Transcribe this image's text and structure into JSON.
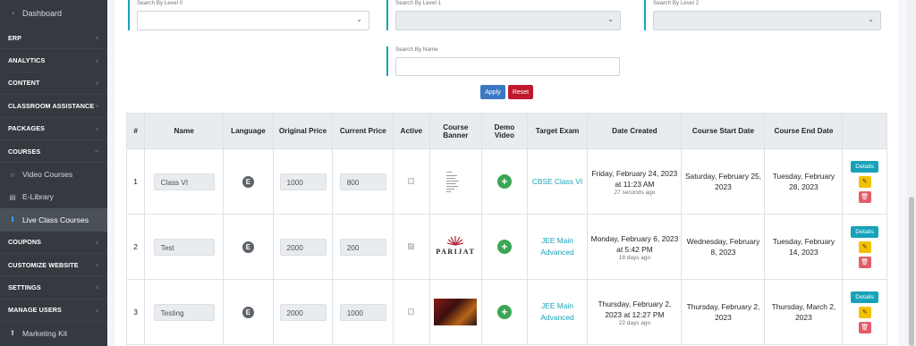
{
  "sidebar": {
    "dashboard": "Dashboard",
    "items": {
      "erp": "ERP",
      "analytics": "ANALYTICS",
      "content": "CONTENT",
      "classroom": "CLASSROOM ASSISTANCE",
      "packages": "PACKAGES",
      "courses": "COURSES",
      "coupons": "COUPONS",
      "customize": "CUSTOMIZE WEBSITE",
      "settings": "SETTINGS",
      "manage_users": "MANAGE USERS"
    },
    "sub": {
      "video": "Video Courses",
      "elibrary": "E-Library",
      "live": "Live Class Courses"
    },
    "marketing": "Marketing Kit",
    "chev": "‹",
    "icons": [
      "dashboard-icon",
      "video-icon",
      "library-icon",
      "live-class-icon",
      "marketing-icon"
    ]
  },
  "filters": {
    "level0": "Search By Level 0",
    "level1": "Search By Level 1",
    "level2": "Search By Level 2",
    "name": "Search By Name",
    "caret": "⌄"
  },
  "buttons": {
    "apply": "Apply",
    "reset": "Reset"
  },
  "table": {
    "headers": {
      "num": "#",
      "name": "Name",
      "language": "Language",
      "original_price": "Original Price",
      "current_price": "Current Price",
      "active": "Active",
      "banner": "Course Banner",
      "demo": "Demo Video",
      "target": "Target Exam",
      "created": "Date Created",
      "start": "Course Start Date",
      "end": "Course End Date"
    },
    "rows": [
      {
        "num": "1",
        "name": "Class VI",
        "lang": "E",
        "original": "1000",
        "current": "800",
        "active": false,
        "banner": "document",
        "target": "CBSE Class VI",
        "created": "Friday, February 24, 2023 at 11:23 AM",
        "created_ago": "27 seconds ago",
        "start": "Saturday, February 25, 2023",
        "end": "Tuesday, February 28, 2023"
      },
      {
        "num": "2",
        "name": "Test",
        "lang": "E",
        "original": "2000",
        "current": "200",
        "active": true,
        "banner": "parijat",
        "target": "JEE Main Advanced",
        "created": "Monday, February 6, 2023 at 5:42 PM",
        "created_ago": "18 days ago",
        "start": "Wednesday, February 8, 2023",
        "end": "Tuesday, February 14, 2023"
      },
      {
        "num": "3",
        "name": "Testing",
        "lang": "E",
        "original": "2000",
        "current": "1000",
        "active": false,
        "banner": "photo",
        "target": "JEE Main Advanced",
        "created": "Thursday, February 2, 2023 at 12:27 PM",
        "created_ago": "22 days ago",
        "start": "Thursday, February 2, 2023",
        "end": "Thursday, March 2, 2023"
      }
    ],
    "details_label": "Details",
    "demo_glyph": "+",
    "parijat_word": "PARIJAT"
  },
  "colors": {
    "sidebar": "#343a40",
    "accent": "#17a2b8",
    "apply": "#3c78c2",
    "reset": "#c0182c",
    "edit": "#f2c200",
    "delete": "#e35d6a",
    "play": "#3aa655"
  }
}
